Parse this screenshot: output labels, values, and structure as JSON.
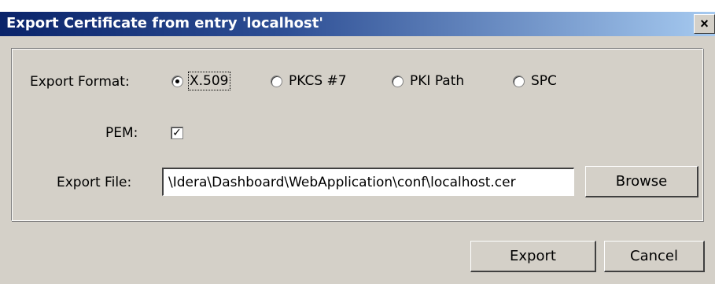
{
  "window": {
    "title": "Export Certificate from entry 'localhost'",
    "close_label": "×"
  },
  "form": {
    "export_format_label": "Export Format:",
    "formats": [
      {
        "label": "X.509",
        "selected": true
      },
      {
        "label": "PKCS #7",
        "selected": false
      },
      {
        "label": "PKI Path",
        "selected": false
      },
      {
        "label": "SPC",
        "selected": false
      }
    ],
    "pem_label": "PEM:",
    "pem_checked": true,
    "pem_check_glyph": "✓",
    "export_file_label": "Export File:",
    "export_file_value": "\\Idera\\Dashboard\\WebApplication\\conf\\localhost.cer",
    "browse_label": "Browse"
  },
  "buttons": {
    "export_label": "Export",
    "cancel_label": "Cancel"
  }
}
